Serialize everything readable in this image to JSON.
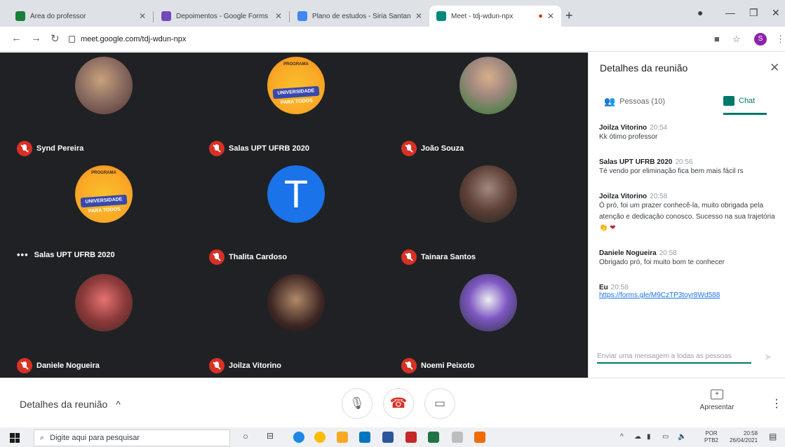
{
  "browser": {
    "tabs": [
      {
        "title": "Área do professor",
        "color": "#188038"
      },
      {
        "title": "Depoimentos - Google Forms",
        "color": "#7248b9"
      },
      {
        "title": "Plano de estudos - Siria Santana",
        "color": "#4285f4"
      },
      {
        "title": "Meet - tdj-wdun-npx",
        "color": "#00897b"
      }
    ],
    "url": "meet.google.com/tdj-wdun-npx",
    "profile_initial": "S"
  },
  "participants": [
    {
      "name": "Synd Pereira",
      "initial": "",
      "photo": "ph-a",
      "muted": true
    },
    {
      "name": "Salas UPT UFRB 2020",
      "initial": "",
      "photo": "ph-upt",
      "muted": true
    },
    {
      "name": "João Souza",
      "initial": "",
      "photo": "ph-b",
      "muted": true
    },
    {
      "name": "Salas UPT UFRB 2020",
      "initial": "",
      "photo": "ph-upt",
      "muted": false
    },
    {
      "name": "Thalita Cardoso",
      "initial": "T",
      "photo": "ph-t",
      "muted": true
    },
    {
      "name": "Tainara Santos",
      "initial": "",
      "photo": "ph-c",
      "muted": true
    },
    {
      "name": "Daniele Nogueira",
      "initial": "",
      "photo": "ph-d",
      "muted": true
    },
    {
      "name": "Joilza Vitorino",
      "initial": "",
      "photo": "ph-e",
      "muted": true
    },
    {
      "name": "Noemi Peixoto",
      "initial": "",
      "photo": "ph-f",
      "muted": true
    }
  ],
  "upt_logo": {
    "top": "PROGRAMA",
    "banner": "UNIVERSIDADE PARA TODOS"
  },
  "panel": {
    "title": "Detalhes da reunião",
    "people_tab": "Pessoas (10)",
    "chat_tab": "Chat",
    "messages": [
      {
        "author": "Joilza Vitorino",
        "time": "20:54",
        "text": "Kk ótimo professor"
      },
      {
        "author": "Salas UPT UFRB 2020",
        "time": "20:56",
        "text": "Té vendo por eliminação fica bem mais fácil rs"
      },
      {
        "author": "Joilza Vitorino",
        "time": "20:58",
        "text": "Ó pró, foi um prazer conhecê-la, muito obrigada pela atenção e dedicação conosco. Sucesso na sua trajetória 👏",
        "heart": "❤"
      },
      {
        "author": "Daniele Nogueira",
        "time": "20:58",
        "text": "Obrigado pró, foi muito bom te conhecer"
      },
      {
        "author": "Eu",
        "time": "20:58",
        "link": "https://forms.gle/M9CzTP3toyr8Wd588"
      }
    ],
    "input_placeholder": "Enviar uma mensagem a todas as pessoas"
  },
  "bottom": {
    "details_label": "Detalhes da reunião",
    "present_label": "Apresentar"
  },
  "taskbar": {
    "search_placeholder": "Digite aqui para pesquisar",
    "lang_top": "POR",
    "lang_bottom": "PTB2",
    "time": "20:58",
    "date": "26/04/2021"
  }
}
